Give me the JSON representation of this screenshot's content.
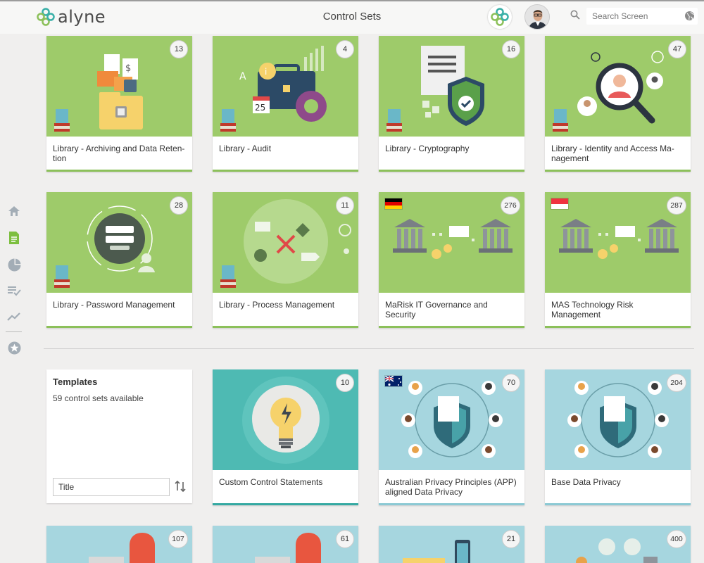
{
  "header": {
    "logo_text": "alyne",
    "title": "Control Sets",
    "search_placeholder": "Search Screen"
  },
  "nav": [
    {
      "name": "home-icon"
    },
    {
      "name": "document-icon",
      "active": true
    },
    {
      "name": "pie-chart-icon"
    },
    {
      "name": "checklist-icon"
    },
    {
      "name": "trend-icon"
    },
    {
      "name": "star-icon"
    }
  ],
  "library_cards": [
    {
      "title": "Library - Archiving and Data Reten-tion",
      "count": "13",
      "theme": "green",
      "icon": "archive-illustration"
    },
    {
      "title": "Library - Audit",
      "count": "4",
      "theme": "green",
      "icon": "briefcase-illustration"
    },
    {
      "title": "Library - Cryptography",
      "count": "16",
      "theme": "green",
      "icon": "shield-illustration"
    },
    {
      "title": "Library - Identity and Access Ma-nagement",
      "count": "47",
      "theme": "green",
      "icon": "magnifier-illustration"
    },
    {
      "title": "Library - Password Management",
      "count": "28",
      "theme": "green",
      "icon": "password-illustration"
    },
    {
      "title": "Library - Process Management",
      "count": "11",
      "theme": "green",
      "icon": "process-illustration"
    },
    {
      "title": "MaRisk IT Governance and Security",
      "count": "276",
      "theme": "green",
      "icon": "banks-illustration",
      "flag": "germany-flag"
    },
    {
      "title": "MAS Technology Risk Management",
      "count": "287",
      "theme": "green",
      "icon": "banks-illustration",
      "flag": "singapore-flag"
    }
  ],
  "templates": {
    "heading": "Templates",
    "available": "59 control sets available",
    "sort_value": "Title"
  },
  "template_cards": [
    {
      "title": "Custom Control Statements",
      "count": "10",
      "theme": "teal",
      "icon": "lightbulb-illustration"
    },
    {
      "title": "Australian Privacy Principles (APP) aligned Data Privacy",
      "count": "70",
      "theme": "blue",
      "icon": "privacy-network-illustration",
      "flag": "australia-flag"
    },
    {
      "title": "Base Data Privacy",
      "count": "204",
      "theme": "blue",
      "icon": "privacy-network-illustration"
    }
  ],
  "bottom_cards": [
    {
      "count": "107",
      "theme": "blue"
    },
    {
      "count": "61",
      "theme": "blue"
    },
    {
      "count": "21",
      "theme": "blue"
    },
    {
      "count": "400",
      "theme": "blue"
    }
  ],
  "colors": {
    "green": "#9ecb6a",
    "teal": "#4ebab3",
    "blue": "#a6d6df",
    "nav_active": "#7dbf3f"
  }
}
